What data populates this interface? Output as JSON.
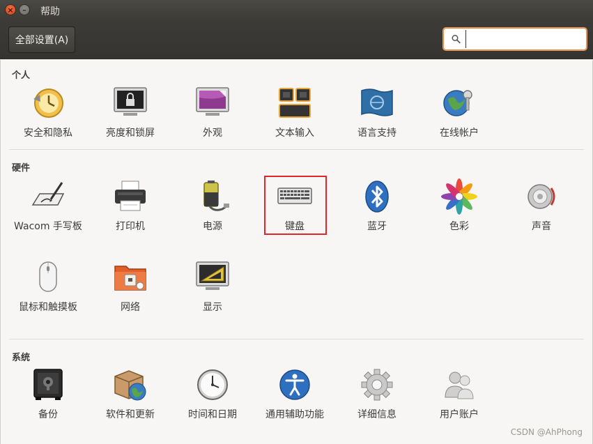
{
  "window": {
    "title": "帮助"
  },
  "toolbar": {
    "all_settings_label": "全部设置(A)",
    "search_value": "",
    "search_placeholder": ""
  },
  "sections": {
    "personal": {
      "title": "个人",
      "items": [
        "安全和隐私",
        "亮度和锁屏",
        "外观",
        "文本输入",
        "语言支持",
        "在线帐户"
      ]
    },
    "hardware": {
      "title": "硬件",
      "items": [
        "Wacom 手写板",
        "打印机",
        "电源",
        "键盘",
        "蓝牙",
        "色彩",
        "声音",
        "鼠标和触摸板",
        "网络",
        "显示"
      ]
    },
    "system": {
      "title": "系统",
      "items": [
        "备份",
        "软件和更新",
        "时间和日期",
        "通用辅助功能",
        "详细信息",
        "用户账户"
      ]
    }
  },
  "watermark": "CSDN @AhPhong",
  "colors": {
    "titlebar": "#3c3b37",
    "search_focus": "#e0863f",
    "highlight": "#e0262c"
  }
}
